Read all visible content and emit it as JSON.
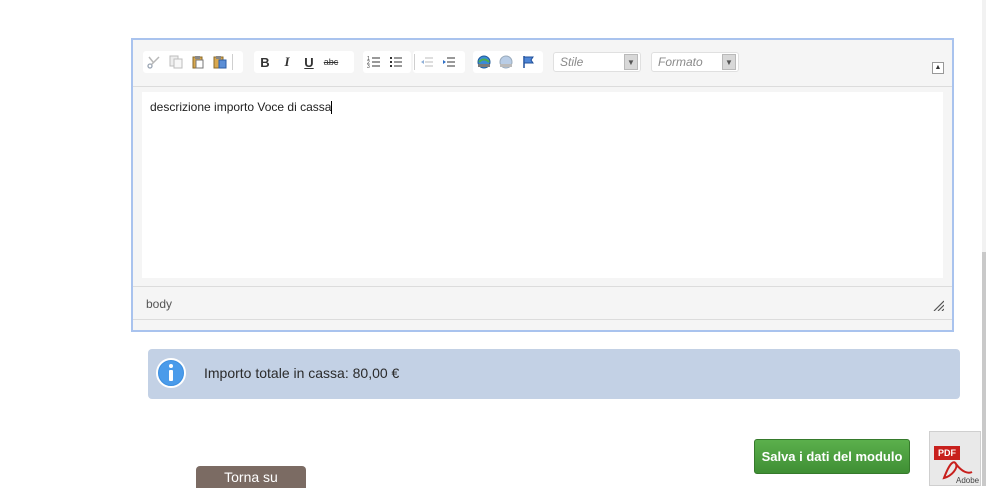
{
  "editor": {
    "toolbar": {
      "icons": [
        "scissors-icon",
        "copy-icon",
        "paste-icon",
        "paste-text-icon",
        "bold",
        "italic",
        "underline",
        "strikethrough",
        "numbered-list-icon",
        "bulleted-list-icon",
        "outdent-icon",
        "indent-icon",
        "link-icon",
        "unlink-icon",
        "anchor-icon"
      ],
      "bold_label": "B",
      "italic_label": "I",
      "underline_label": "U",
      "strike_label": "abc",
      "style_combo_label": "Stile",
      "format_combo_label": "Formato"
    },
    "content_text": "descrizione importo Voce di cassa",
    "path_label": "body"
  },
  "info": {
    "text": "Importo totale in cassa: 80,00 €"
  },
  "actions": {
    "save_label": "Salva i dati del modulo",
    "back_to_top_label": "Torna su",
    "pdf_tag": "PDF",
    "pdf_sub": "Adobe"
  },
  "colors": {
    "editor_border": "#a9c3ee",
    "info_bg": "#c3d1e5",
    "save_bg": "#4a9e3e",
    "back_top_bg": "#7b6b63"
  }
}
